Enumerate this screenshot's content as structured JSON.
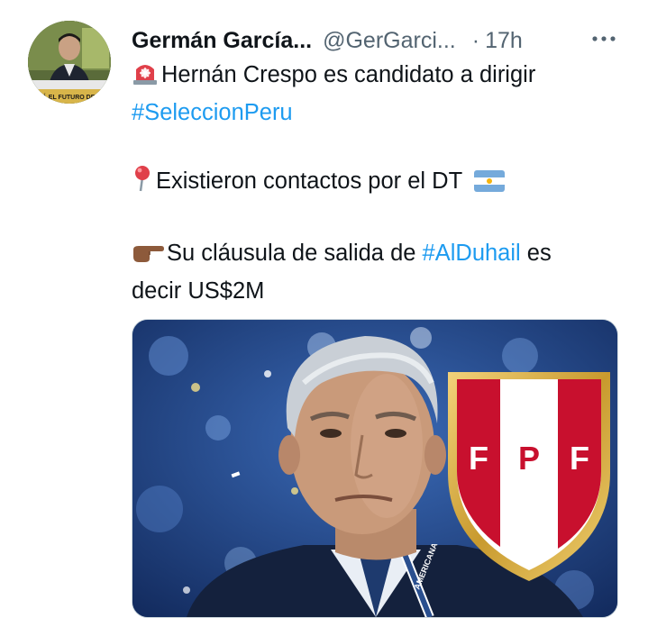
{
  "tweet": {
    "author_name": "Germán García...",
    "handle": "@GerGarci...",
    "separator": "·",
    "timestamp": "17h",
    "more_icon": "more-horizontal-icon",
    "avatar_caption": "SERÁ EL FUTURO DE DAV",
    "text": {
      "line1_emoji": "rotating-light-emoji",
      "line1": "Hernán Crespo es candidato a dirigir",
      "line2_hashtag": "#SeleccionPeru",
      "line3_emoji": "round-pushpin-emoji",
      "line3": "Existieron contactos por el DT",
      "line3_flag": "argentina-flag-emoji",
      "line4_emoji": "backhand-index-pointing-right-emoji",
      "line4_pre": "Su cláusula de salida de",
      "line4_hashtag": "#AlDuhail",
      "line4_post": "es",
      "line5": "decir US$2M"
    },
    "media": {
      "description_icon": "photo",
      "badge_letters": [
        "F",
        "P",
        "F"
      ],
      "jersey_text": "AMERICANA"
    },
    "colors": {
      "text": "#0f1419",
      "secondary": "#536471",
      "link": "#1d9bf0",
      "badge_red": "#c8102e",
      "badge_gold": "#d4a93a"
    }
  }
}
